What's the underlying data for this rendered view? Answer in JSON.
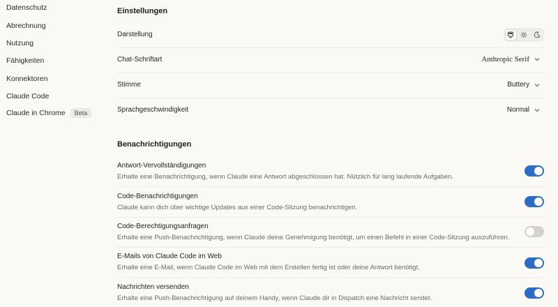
{
  "sidebar": {
    "items": [
      {
        "label": "Datenschutz"
      },
      {
        "label": "Abrechnung"
      },
      {
        "label": "Nutzung"
      },
      {
        "label": "Fähigkeiten"
      },
      {
        "label": "Konnektoren"
      },
      {
        "label": "Claude Code"
      },
      {
        "label": "Claude in Chrome",
        "badge": "Beta"
      }
    ]
  },
  "settings": {
    "title": "Einstellungen",
    "appearance_label": "Darstellung",
    "appearance_options": [
      "system",
      "light",
      "dark"
    ],
    "appearance_selected": "system",
    "font_label": "Chat-Schriftart",
    "font_value": "Anthropic Serif",
    "voice_label": "Stimme",
    "voice_value": "Buttery",
    "speed_label": "Sprachgeschwindigkeit",
    "speed_value": "Normal"
  },
  "notifications": {
    "title": "Benachrichtigungen",
    "items": [
      {
        "label": "Antwort-Vervollständigungen",
        "desc": "Erhalte eine Benachrichtigung, wenn Claude eine Antwort abgeschlossen hat. Nützlich für lang laufende Aufgaben.",
        "enabled": true
      },
      {
        "label": "Code-Benachrichtigungen",
        "desc": "Claude kann dich über wichtige Updates aus einer Code-Sitzung benachrichtigen.",
        "enabled": true
      },
      {
        "label": "Code-Berechtigungsanfragen",
        "desc": "Erhalte eine Push-Benachrichtigung, wenn Claude deine Genehmigung benötigt, um einen Befehl in einer Code-Sitzung auszuführen.",
        "enabled": false
      },
      {
        "label": "E-Mails von Claude Code im Web",
        "desc": "Erhalte eine E-Mail, wenn Claude Code im Web mit dem Erstellen fertig ist oder deine Antwort benötigt.",
        "enabled": true
      },
      {
        "label": "Nachrichten versenden",
        "desc": "Erhalte eine Push-Benachrichtigung auf deinem Handy, wenn Claude dir in Dispatch eine Nachricht sendet.",
        "enabled": true
      }
    ]
  },
  "colors": {
    "accent": "#2c6cc4",
    "toggle_off": "#d4d2cb",
    "background": "#faf9f5"
  }
}
